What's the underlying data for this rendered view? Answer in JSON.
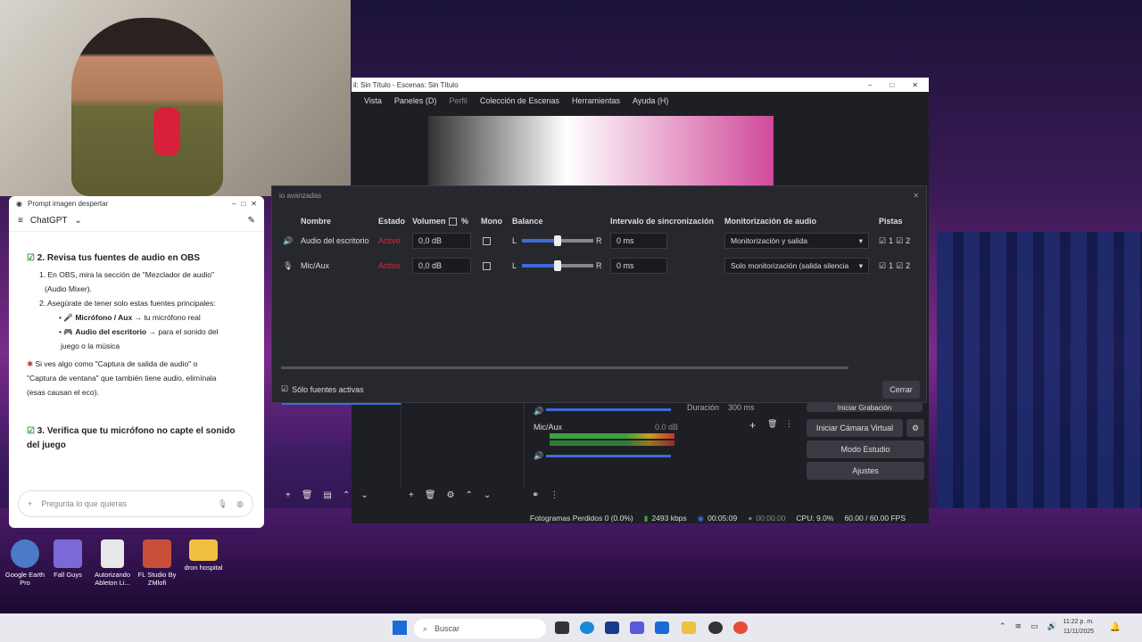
{
  "webcam": {
    "label": "webcam-feed"
  },
  "chatgpt": {
    "window_title": "Prompt imagen despertar",
    "app_label": "ChatGPT",
    "section2_title": "2. Revisa tus fuentes de audio en OBS",
    "s2_item1": "En OBS, mira la sección de \"Mezclador de audio\"",
    "s2_item1b": "(Audio Mixer).",
    "s2_item2": "Asegúrate de tener solo estas fuentes principales:",
    "s2_b1_bold": "Micrófono / Aux",
    "s2_b1_rest": " → tu micrófono real",
    "s2_b2_bold": "Audio del escritorio",
    "s2_b2_rest": " → para el sonido del",
    "s2_b2_cont": "juego o la música",
    "warn1": "Si ves algo como \"Captura de salida de audio\" o",
    "warn2": "\"Captura de ventana\" que también tiene audio, elimínala",
    "warn3": "(esas causan el eco).",
    "section3_title": "3. Verifica que tu micrófono no capte el sonido",
    "section3_cont": "del juego",
    "input_placeholder": "Pregunta lo que quieras"
  },
  "obs": {
    "window_title": "il: Sin Título - Escenas: Sin Título",
    "menu": [
      "Vista",
      "Paneles (D)",
      "Perfil",
      "Colección de Escenas",
      "Herramientas",
      "Ayuda (H)"
    ],
    "dialog_title": "io avanzadas",
    "headers": {
      "nombre": "Nombre",
      "estado": "Estado",
      "volumen": "Volumen",
      "pct": "%",
      "mono": "Mono",
      "balance": "Balance",
      "sync": "Intervalo de sincronización",
      "monitor": "Monitorización de audio",
      "tracks": "Pistas"
    },
    "rows": [
      {
        "name": "Audio del escritorio",
        "status": "Activo",
        "volume": "0,0 dB",
        "l": "L",
        "r": "R",
        "sync": "0 ms",
        "monitor": "Monitorización y salida",
        "t1": "1",
        "t2": "2"
      },
      {
        "name": "Mic/Aux",
        "status": "Activo",
        "volume": "0,0 dB",
        "l": "L",
        "r": "R",
        "sync": "0 ms",
        "monitor": "Solo monitorización (salida silencia",
        "t1": "1",
        "t2": "2"
      }
    ],
    "only_active": "Sólo fuentes activas",
    "close_btn": "Cerrar",
    "mixer_label": "Mic/Aux",
    "mixer_db": "0.0 dB",
    "duration_label": "Duración",
    "duration_value": "300 ms",
    "start_recording": "Iniciar Grabación",
    "virtual_cam": "Iniciar Cámara Virtual",
    "studio_mode": "Modo Estudio",
    "settings": "Ajustes",
    "status_dropped": "Fotogramas Perdidos 0 (0.0%)",
    "status_kbps": "2493 kbps",
    "status_time1": "00:05:09",
    "status_time2": "00:00:00",
    "status_cpu": "CPU: 9.0%",
    "status_fps": "60.00 / 60.00 FPS"
  },
  "desktop_icons": [
    {
      "label": "Google Earth Pro",
      "color": "#4a7ac8"
    },
    {
      "label": "Fall Guys",
      "color": "#7a6ad8"
    },
    {
      "label": "Autorizando Ableton Li...",
      "color": "#e8e8e8"
    },
    {
      "label": "FL Studio By ZMlofi",
      "color": "#c8503a"
    },
    {
      "label": "dron hospital",
      "color": "#f0c040"
    }
  ],
  "taskbar": {
    "search_placeholder": "Buscar",
    "time": "11:22 p. m.",
    "date": "11/11/2025"
  }
}
